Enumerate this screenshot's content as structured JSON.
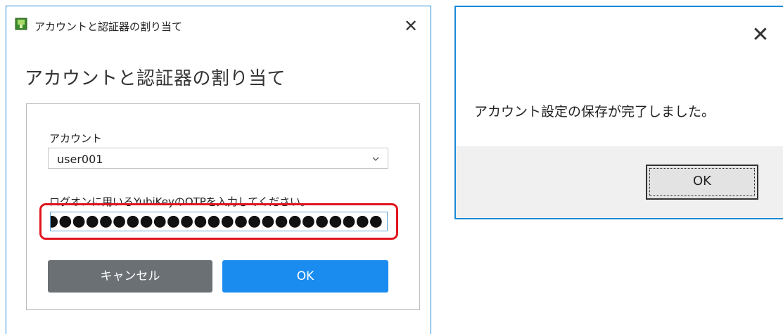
{
  "dialog_assign": {
    "window_title": "アカウントと認証器の割り当て",
    "heading": "アカウントと認証器の割り当て",
    "account_label": "アカウント",
    "account_selected": "user001",
    "otp_label": "ログオンに用いるYubiKeyのOTPを入力してください。",
    "otp_value": ")●●●●●●●●●●●●●●●●●●●●●●●●●●●●",
    "cancel_label": "キャンセル",
    "ok_label": "OK",
    "close_glyph": "✕"
  },
  "dialog_saved": {
    "message": "アカウント設定の保存が完了しました。",
    "ok_label": "OK",
    "close_glyph": "✕"
  },
  "colors": {
    "title_border": "#1b8ad6",
    "highlight": "#e0141c",
    "ok_button": "#1a8cf0",
    "cancel_button": "#6b7075"
  },
  "icons": {
    "app": "app-shield-icon",
    "dropdown": "chevron-down-icon",
    "close": "close-icon"
  }
}
